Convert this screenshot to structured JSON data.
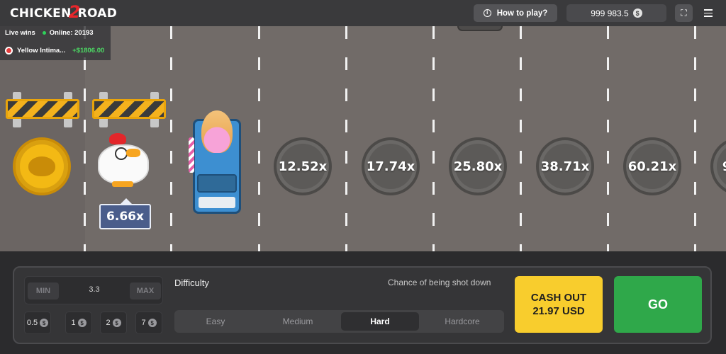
{
  "header": {
    "logo_left": "CHICKEN",
    "logo_num": "2",
    "logo_right": "ROAD",
    "help_label": "How to play?",
    "balance": "999 983.5",
    "currency_symbol": "$"
  },
  "live": {
    "title": "Live wins",
    "online": "Online: 20193",
    "player": "Yellow Intima...",
    "amount": "+$1806.00"
  },
  "game": {
    "current_multiplier": "6.66x",
    "lane_multipliers": [
      "12.52x",
      "17.74x",
      "25.80x",
      "38.71x",
      "60.21x",
      "9"
    ]
  },
  "controls": {
    "min_label": "MIN",
    "max_label": "MAX",
    "bet_value": "3.3",
    "chips": [
      "0.5",
      "1",
      "2",
      "7"
    ],
    "difficulty_label": "Difficulty",
    "chance_label": "Chance of being shot down",
    "difficulties": [
      "Easy",
      "Medium",
      "Hard",
      "Hardcore"
    ],
    "active_difficulty": "Hard",
    "cashout_line1": "CASH OUT",
    "cashout_line2": "21.97 USD",
    "go_label": "GO"
  },
  "colors": {
    "cashout": "#f8cd2d",
    "go": "#2fa84a",
    "win_green": "#4cd964",
    "road": "#716b68"
  }
}
